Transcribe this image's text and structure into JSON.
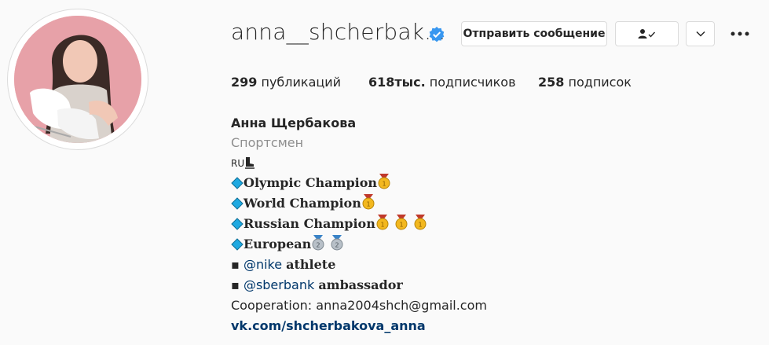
{
  "profile": {
    "username": "anna__shcherbak...",
    "verified_icon": "verified-badge-icon",
    "avatar_alt": "profile-photo"
  },
  "actions": {
    "message_label": "Отправить сообщение",
    "follow_icon": "user-check-icon",
    "more_icon": "chevron-down-icon",
    "options_icon": "three-dots-icon"
  },
  "stats": {
    "posts_count": "299",
    "posts_label": "публикаций",
    "followers_count": "618тыс.",
    "followers_label": "подписчиков",
    "following_count": "258",
    "following_label": "подписок"
  },
  "bio": {
    "full_name": "Анна Щербакова",
    "category": "Спортсмен",
    "line_ru": "RU",
    "line_olympic": "Olympic Champion",
    "line_world": "World Champion",
    "line_russian": "Russian Champion",
    "line_european": "European",
    "bullet": "▪",
    "nike_mention": "@nike",
    "nike_role": "athlete",
    "sber_mention": "@sberbank",
    "sber_role": "ambassador",
    "cooperation": "Cooperation: anna2004shch@gmail.com",
    "website": "vk.com/shcherbakova_anna"
  },
  "colors": {
    "verified": "#3897f0",
    "link": "#00376b",
    "secondary_text": "#8e8e8e",
    "border": "#dbdbdb",
    "diamond": "#1fa9e1",
    "gold_medal": "#f3b81f",
    "silver_medal": "#b8c0c8",
    "ribbon_red": "#c0392b",
    "ribbon_blue": "#3a83c7"
  }
}
